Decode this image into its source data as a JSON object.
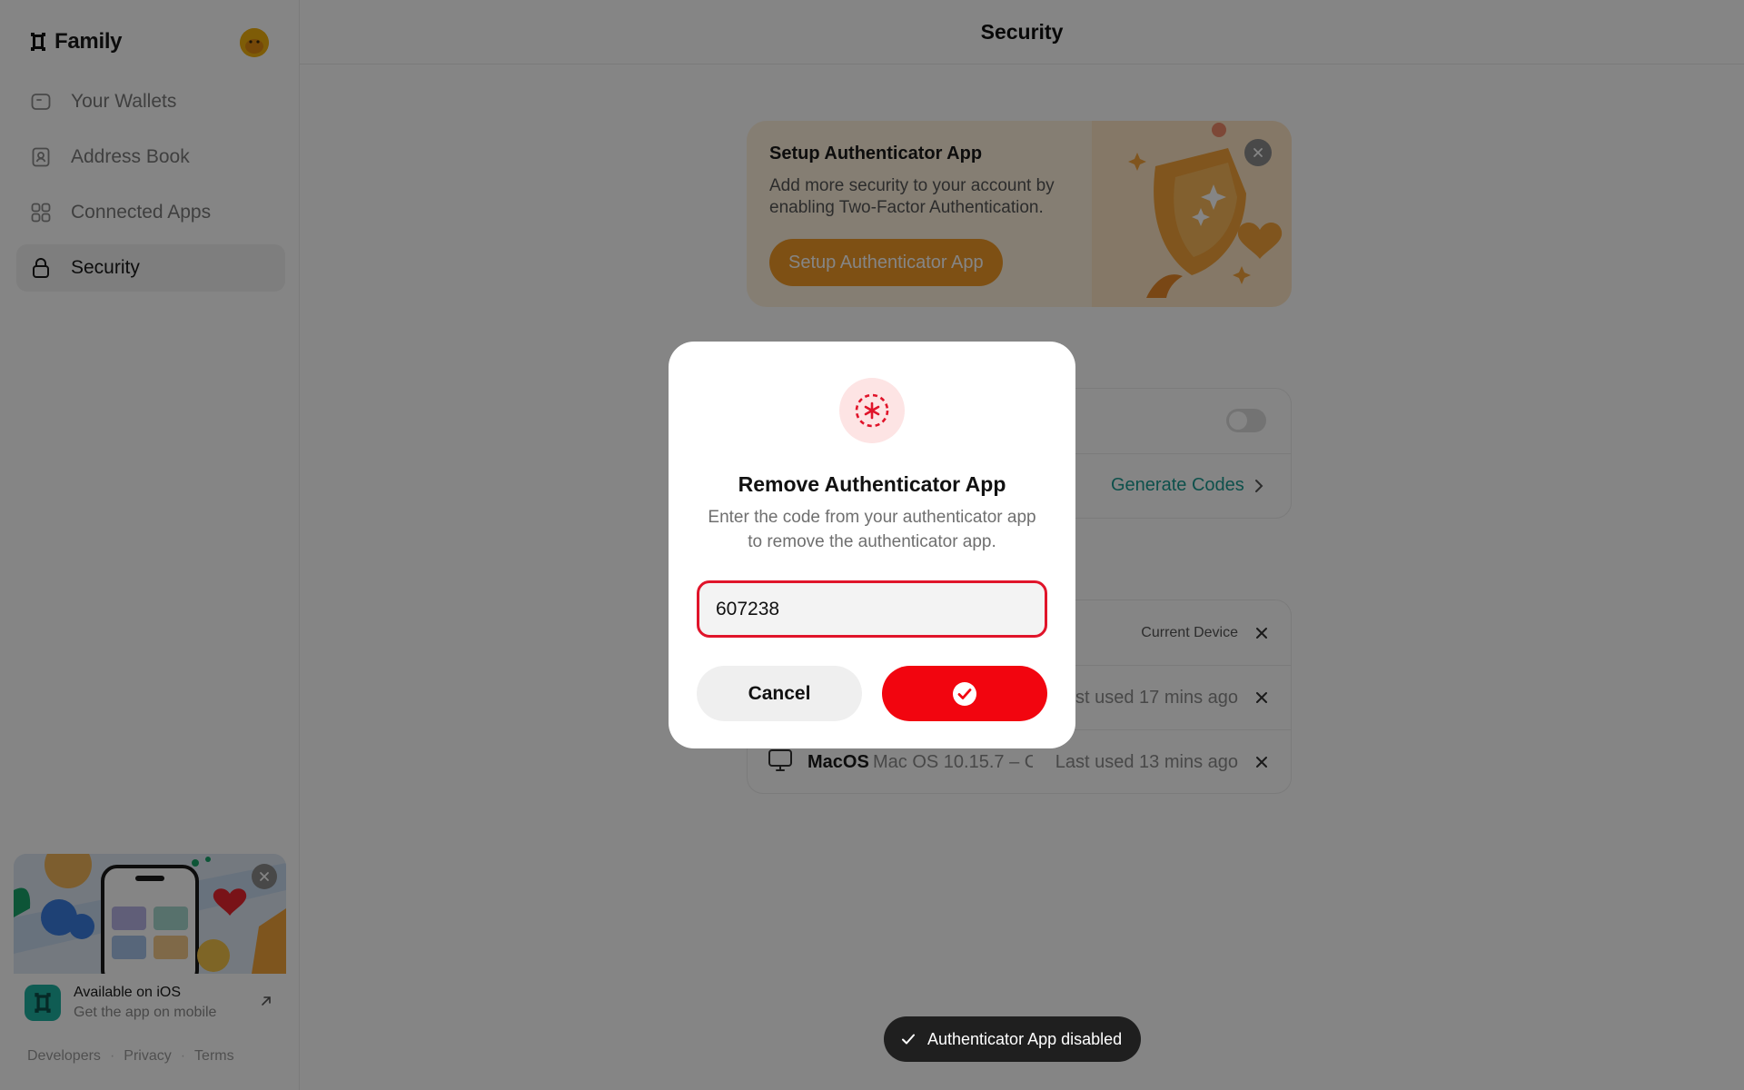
{
  "app": {
    "brand_name": "Family"
  },
  "sidebar": {
    "items": [
      {
        "label": "Your Wallets",
        "icon": "wallet-icon"
      },
      {
        "label": "Address Book",
        "icon": "address-book-icon"
      },
      {
        "label": "Connected Apps",
        "icon": "apps-grid-icon"
      },
      {
        "label": "Security",
        "icon": "lock-icon",
        "active": true
      }
    ],
    "promo": {
      "title": "Available on iOS",
      "subtitle": "Get the app on mobile"
    },
    "footer_links": [
      "Developers",
      "Privacy",
      "Terms"
    ]
  },
  "header": {
    "title": "Security"
  },
  "setup_card": {
    "title": "Setup Authenticator App",
    "description": "Add more security to your account by enabling Two-Factor Authentication.",
    "button_label": "Setup Authenticator App"
  },
  "two_factor": {
    "toggle_on": false,
    "generate_codes_label": "Generate Codes"
  },
  "devices": [
    {
      "name": "",
      "os": "",
      "meta": "Current Device"
    },
    {
      "name": "",
      "os": "",
      "meta": "Last used 17 mins ago"
    },
    {
      "name": "MacOS",
      "os": "Mac OS 10.15.7 – C",
      "meta": "Last used 13 mins ago"
    }
  ],
  "modal": {
    "title": "Remove Authenticator App",
    "description": "Enter the code from your authenticator app to remove the authenticator app.",
    "code_value": "607238",
    "cancel_label": "Cancel"
  },
  "toast": {
    "message": "Authenticator App disabled"
  },
  "colors": {
    "accent_red": "#f2050f",
    "accent_teal": "#1a9a90",
    "setup_orange": "#f29a27",
    "toast_bg": "#1f1f1f"
  }
}
